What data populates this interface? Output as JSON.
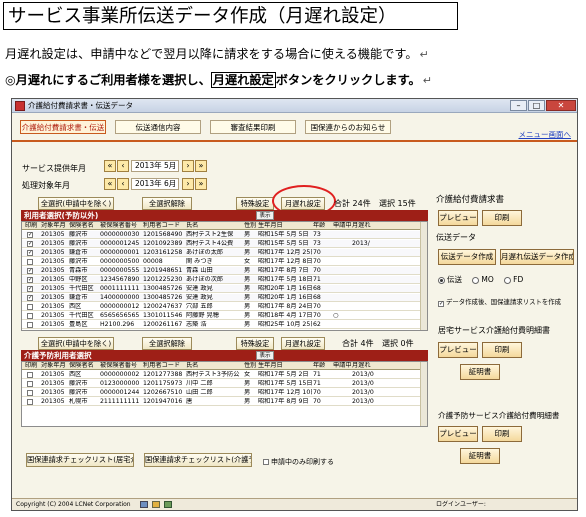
{
  "doc": {
    "title": "サービス事業所伝送データ作成（月遅れ設定）",
    "desc1": "月遅れ設定は、申請中などで翌月以降に請求をする場合に使える機能です。",
    "desc2_prefix": "◎月遅れにするご利用者様を選択し、",
    "desc2_boxed": "月遅れ設定",
    "desc2_suffix": "ボタンをクリックします。",
    "return_mark": "↵"
  },
  "window": {
    "title": "介護給付費請求書・伝送データ",
    "min": "–",
    "max": "□",
    "close": "✕"
  },
  "tabs": [
    "介護給付費請求書・伝送",
    "伝送通信内容",
    "審査結果印刷",
    "国保連からのお知らせ"
  ],
  "menu_link": "メニュー画面へ",
  "service_year_month": {
    "label": "サービス提供年月",
    "value": "2013年 5月"
  },
  "process_year_month": {
    "label": "処理対象年月",
    "value": "2013年 6月"
  },
  "nav": {
    "first": "«",
    "prev": "‹",
    "next": "›",
    "last": "»"
  },
  "upper": {
    "btn_select_all": "全選択(申請中を除く)",
    "btn_clear_all": "全選択解除",
    "btn_special": "特殊設定",
    "btn_late": "月遅れ設定",
    "total": "合計 24件",
    "selected": "選択 15件",
    "header": "利用者選択(予防以外)",
    "tag": "表示",
    "columns": [
      "印刷",
      "対象年月",
      "保険者名",
      "被保険者番号",
      "利用者コード",
      "氏名",
      "性別",
      "生年月日",
      "年齢",
      "申請中",
      "月遅れ"
    ],
    "rows": [
      {
        "chk": "✓",
        "ym": "201305",
        "ins": "藤沢市",
        "no": "0000000030",
        "code": "1201568490",
        "name": "西村テスト2生保",
        "sex": "男",
        "birth": "昭和15年 5月 5日",
        "age": "73",
        "app": "",
        "late": ""
      },
      {
        "chk": "✓",
        "ym": "201305",
        "ins": "藤沢市",
        "no": "0000001245",
        "code": "1201092389",
        "name": "西村テスト4公費",
        "sex": "男",
        "birth": "昭和15年 5月 5日",
        "age": "73",
        "app": "",
        "late": "2013/"
      },
      {
        "chk": "✓",
        "ym": "201305",
        "ins": "鎌倉市",
        "no": "0000000001",
        "code": "1203161258",
        "name": "あけぼの太郎",
        "sex": "男",
        "birth": "昭和17年 12月 25日",
        "age": "70",
        "app": "",
        "late": ""
      },
      {
        "chk": "",
        "ym": "201305",
        "ins": "藤沢市",
        "no": "0000000500",
        "code": "00008",
        "name": "関 みつき",
        "sex": "女",
        "birth": "昭和17年 12月 8日",
        "age": "70",
        "app": "",
        "late": ""
      },
      {
        "chk": "✓",
        "ym": "201305",
        "ins": "青森市",
        "no": "0000000555",
        "code": "1201948651",
        "name": "青森 山田",
        "sex": "男",
        "birth": "昭和17年 8月 7日",
        "age": "70",
        "app": "",
        "late": ""
      },
      {
        "chk": "✓",
        "ym": "201305",
        "ins": "中野区",
        "no": "1234567890",
        "code": "1201225230",
        "name": "あけぼの次郎",
        "sex": "男",
        "birth": "昭和17年 5月 18日",
        "age": "71",
        "app": "",
        "late": ""
      },
      {
        "chk": "✓",
        "ym": "201305",
        "ins": "千代田区",
        "no": "0001111111",
        "code": "1300485726",
        "name": "安達 政見",
        "sex": "男",
        "birth": "昭和20年 1月 16日",
        "age": "68",
        "app": "",
        "late": ""
      },
      {
        "chk": "✓",
        "ym": "201305",
        "ins": "鎌倉市",
        "no": "1400000000",
        "code": "1300485726",
        "name": "安達 政見",
        "sex": "男",
        "birth": "昭和20年 1月 16日",
        "age": "68",
        "app": "",
        "late": ""
      },
      {
        "chk": "",
        "ym": "201305",
        "ins": "西区",
        "no": "0000000012",
        "code": "1200247637",
        "name": "穴部 五郎",
        "sex": "男",
        "birth": "昭和17年 8月 24日",
        "age": "70",
        "app": "",
        "late": ""
      },
      {
        "chk": "",
        "ym": "201305",
        "ins": "千代田区",
        "no": "6565656565",
        "code": "1301011546",
        "name": "阿藤野 晃穂",
        "sex": "男",
        "birth": "昭和18年 4月 17日",
        "age": "70",
        "app": "○",
        "late": ""
      },
      {
        "chk": "",
        "ym": "201305",
        "ins": "豊島区",
        "no": "H2100.296",
        "code": "1200261167",
        "name": "志築 浩",
        "sex": "男",
        "birth": "昭和25年 10月 25日",
        "age": "62",
        "app": "",
        "late": ""
      },
      {
        "chk": "",
        "ym": "201305",
        "ins": "新潟区",
        "no": "9999999999",
        "code": "1200218688",
        "name": "介護 二郎",
        "sex": "男",
        "birth": "昭和42年 1月 15日",
        "age": "46",
        "app": "",
        "late": ""
      }
    ]
  },
  "lower": {
    "btn_select_all": "全選択(申請中を除く)",
    "btn_clear_all": "全選択解除",
    "btn_special": "特殊設定",
    "btn_late": "月遅れ設定",
    "total": "合計 4件",
    "selected": "選択 0件",
    "header": "介護予防利用者選択",
    "tag": "表示",
    "columns": [
      "印刷",
      "対象年月",
      "保険者名",
      "被保険者番号",
      "利用者コード",
      "氏名",
      "性別",
      "生年月日",
      "年齢",
      "申請中",
      "月遅れ"
    ],
    "rows": [
      {
        "chk": "",
        "ym": "201305",
        "ins": "西区",
        "no": "0000000002",
        "code": "1201277388",
        "name": "西村テスト3予防公",
        "sex": "女",
        "birth": "昭和17年 5月 2日",
        "age": "71",
        "app": "",
        "late": "2013/0"
      },
      {
        "chk": "",
        "ym": "201305",
        "ins": "藤沢市",
        "no": "0123000000",
        "code": "1201175973",
        "name": "川中 二郎",
        "sex": "男",
        "birth": "昭和17年 5月 15日",
        "age": "71",
        "app": "",
        "late": "2013/0"
      },
      {
        "chk": "",
        "ym": "201305",
        "ins": "藤沢市",
        "no": "0000001244",
        "code": "1202667510",
        "name": "山田 二郎",
        "sex": "男",
        "birth": "昭和17年 12月 10日",
        "age": "70",
        "app": "",
        "late": "2013/0"
      },
      {
        "chk": "",
        "ym": "201305",
        "ins": "札幌市",
        "no": "2111111111",
        "code": "1201947016",
        "name": "唐",
        "sex": "男",
        "birth": "昭和17年 8月 9日",
        "age": "70",
        "app": "",
        "late": "2013/0"
      }
    ]
  },
  "bottom": {
    "btn_check1": "国保連請求チェックリスト(居宅介護)",
    "btn_check2": "国保連請求チェックリスト(介護予防)",
    "chk_label": "申請中のみ印刷する"
  },
  "right": {
    "section1": "介護給付費請求書",
    "preview": "プレビュー",
    "print": "印刷",
    "section_data": "伝送データ",
    "btn_create": "伝送データ作成",
    "btn_create_late": "月遅れ伝送データ作成",
    "radio_send": "伝送",
    "radio_mo": "MO",
    "radio_fd": "FD",
    "chk_auto": "データ作成後、国保連請求リストを作成",
    "section2": "居宅サービス介護給付費明細書",
    "preview2": "プレビュー",
    "print2": "印刷",
    "cert2": "証明書",
    "section3": "介護予防サービス介護給付費明細書",
    "preview3": "プレビュー",
    "print3": "印刷",
    "cert3": "証明書"
  },
  "status": {
    "copyright": "Copyright (C) 2004 LCNet Corporation",
    "login": "ログインユーザー:"
  }
}
